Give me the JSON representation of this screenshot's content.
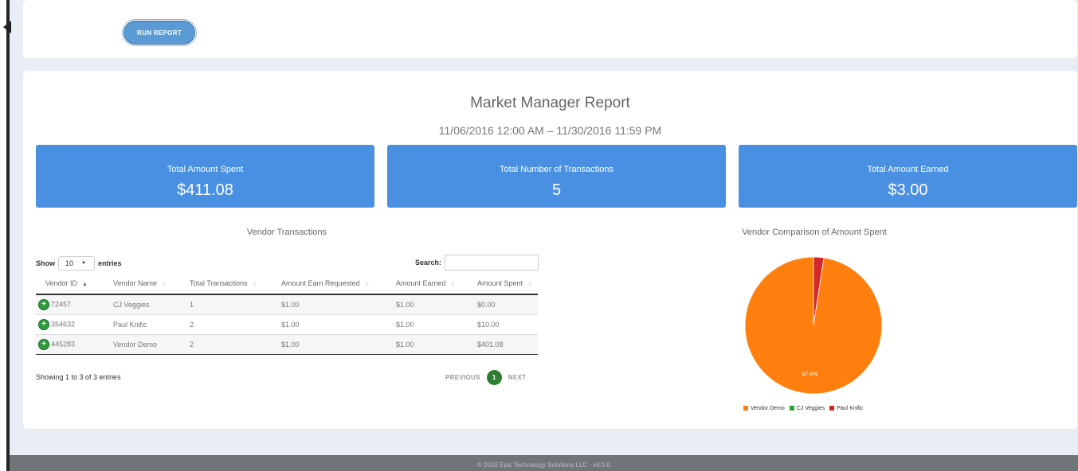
{
  "controls": {
    "run_report_label": "RUN REPORT"
  },
  "report": {
    "title": "Market Manager Report",
    "date_range": "11/06/2016 12:00 AM – 11/30/2016 11:59 PM"
  },
  "stats": [
    {
      "label": "Total Amount Spent",
      "value": "$411.08"
    },
    {
      "label": "Total Number of Transactions",
      "value": "5"
    },
    {
      "label": "Total Amount Earned",
      "value": "$3.00"
    }
  ],
  "vendor_table": {
    "title": "Vendor Transactions",
    "show_label": "Show",
    "entries_value": "10",
    "entries_label": "entries",
    "search_label": "Search:",
    "search_value": "",
    "columns": [
      "Vendor ID",
      "Vendor Name",
      "Total Transactions",
      "Amount Earn Requested",
      "Amount Earned",
      "Amount Spent"
    ],
    "rows": [
      [
        "72457",
        "CJ Veggies",
        "1",
        "$1.00",
        "$1.00",
        "$0.00"
      ],
      [
        "354632",
        "Paul Knific",
        "2",
        "$1.00",
        "$1.00",
        "$10.00"
      ],
      [
        "445283",
        "Vendor Demo",
        "2",
        "$1.00",
        "$1.00",
        "$401.08"
      ]
    ],
    "info": "Showing 1 to 3 of 3 entries",
    "prev_label": "PREVIOUS",
    "current_page": "1",
    "next_label": "NEXT"
  },
  "chart_data": {
    "type": "pie",
    "title": "Vendor Comparison of Amount Spent",
    "categories": [
      "Vendor Demo",
      "CJ Veggies",
      "Paul Knific"
    ],
    "values": [
      401.08,
      0.0,
      10.0
    ],
    "colors": [
      "#ff7f0e",
      "#2ca02c",
      "#d62728"
    ],
    "slice_label": "97.6%",
    "legend": "bottom"
  },
  "footer": {
    "text": "© 2016 Epic Technology Solutions LLC - v4.0.0"
  }
}
